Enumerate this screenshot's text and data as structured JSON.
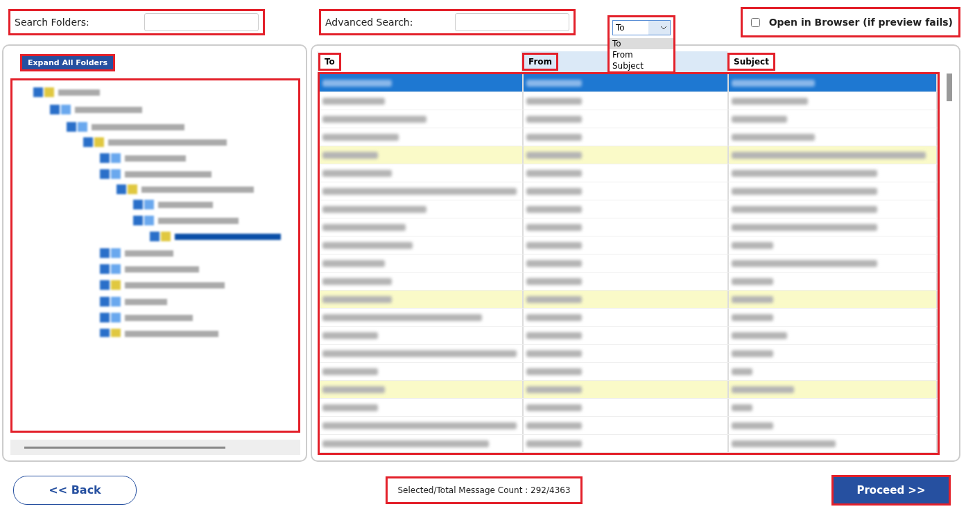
{
  "search_folders": {
    "label": "Search Folders:"
  },
  "advanced_search": {
    "label": "Advanced Search:"
  },
  "field_select": {
    "value": "To",
    "expanded": true,
    "options": [
      {
        "label": "To",
        "selected": true
      },
      {
        "label": "From",
        "selected": false
      },
      {
        "label": "Subject",
        "selected": false
      }
    ]
  },
  "open_in_browser": {
    "label": "Open in Browser (if preview fails)",
    "checked": false
  },
  "expand_button": "Expand All Folders",
  "table": {
    "columns": [
      "To",
      "From",
      "Subject"
    ],
    "rows": [
      {
        "selected": true,
        "flagged": false
      },
      {
        "selected": false,
        "flagged": false
      },
      {
        "selected": false,
        "flagged": false
      },
      {
        "selected": false,
        "flagged": false
      },
      {
        "selected": false,
        "flagged": true
      },
      {
        "selected": false,
        "flagged": false
      },
      {
        "selected": false,
        "flagged": false
      },
      {
        "selected": false,
        "flagged": false
      },
      {
        "selected": false,
        "flagged": false
      },
      {
        "selected": false,
        "flagged": false
      },
      {
        "selected": false,
        "flagged": false
      },
      {
        "selected": false,
        "flagged": false
      },
      {
        "selected": false,
        "flagged": true
      },
      {
        "selected": false,
        "flagged": false
      },
      {
        "selected": false,
        "flagged": false
      },
      {
        "selected": false,
        "flagged": false
      },
      {
        "selected": false,
        "flagged": false
      },
      {
        "selected": false,
        "flagged": true
      },
      {
        "selected": false,
        "flagged": false
      },
      {
        "selected": false,
        "flagged": false
      },
      {
        "selected": false,
        "flagged": false
      }
    ]
  },
  "back_button": "<< Back",
  "message_count": "Selected/Total Message Count : 292/4363",
  "proceed_button": "Proceed >>"
}
